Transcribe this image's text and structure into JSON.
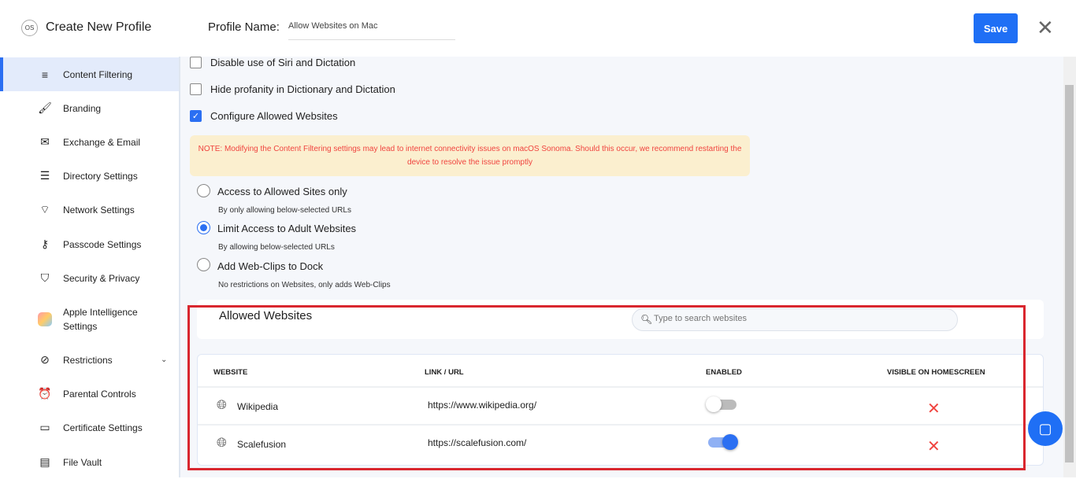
{
  "header": {
    "logo": "OS",
    "title": "Create New Profile",
    "profile_name_label": "Profile Name:",
    "profile_name_value": "Allow Websites on Mac",
    "save_label": "Save",
    "close_icon": "close-icon"
  },
  "sidebar": {
    "items": [
      {
        "label": "Content Filtering",
        "icon": "filter-icon",
        "active": true
      },
      {
        "label": "Branding",
        "icon": "brush-icon"
      },
      {
        "label": "Exchange & Email",
        "icon": "mail-icon"
      },
      {
        "label": "Directory Settings",
        "icon": "directory-icon"
      },
      {
        "label": "Network Settings",
        "icon": "wifi-icon"
      },
      {
        "label": "Passcode Settings",
        "icon": "key-icon"
      },
      {
        "label": "Security & Privacy",
        "icon": "shield-icon"
      },
      {
        "label": "Apple Intelligence Settings",
        "icon": "apple-intelligence-icon"
      },
      {
        "label": "Restrictions",
        "icon": "block-icon",
        "expandable": true
      },
      {
        "label": "Parental Controls",
        "icon": "alarm-icon"
      },
      {
        "label": "Certificate Settings",
        "icon": "certificate-icon"
      },
      {
        "label": "File Vault",
        "icon": "file-icon"
      }
    ]
  },
  "options": {
    "checkboxes": [
      {
        "label": "Disable use of Siri and Dictation",
        "checked": false
      },
      {
        "label": "Hide profanity in Dictionary and Dictation",
        "checked": false
      },
      {
        "label": "Configure Allowed Websites",
        "checked": true
      }
    ],
    "note": "NOTE: Modifying the Content Filtering settings may lead to internet connectivity issues on macOS Sonoma. Should this occur, we recommend restarting the device to resolve the issue promptly",
    "radios": [
      {
        "label": "Access to Allowed Sites only",
        "sub": "By only allowing below-selected URLs",
        "selected": false
      },
      {
        "label": "Limit Access to Adult Websites",
        "sub": "By allowing below-selected URLs",
        "selected": true
      },
      {
        "label": "Add Web-Clips to Dock",
        "sub": "No restrictions on Websites, only adds Web-Clips",
        "selected": false
      }
    ]
  },
  "allowed": {
    "title": "Allowed Websites",
    "search_placeholder": "Type to search websites",
    "columns": [
      "WEBSITE",
      "LINK / URL",
      "ENABLED",
      "VISIBLE ON HOMESCREEN"
    ],
    "rows": [
      {
        "name": "Wikipedia",
        "url": "https://www.wikipedia.org/",
        "enabled": false,
        "visible": false
      },
      {
        "name": "Scalefusion",
        "url": "https://scalefusion.com/",
        "enabled": true,
        "visible": false
      }
    ]
  },
  "colors": {
    "accent": "#1f6ff5",
    "error": "#f0443f",
    "note_bg": "#fbefcf",
    "highlight_box": "#d9262e"
  }
}
